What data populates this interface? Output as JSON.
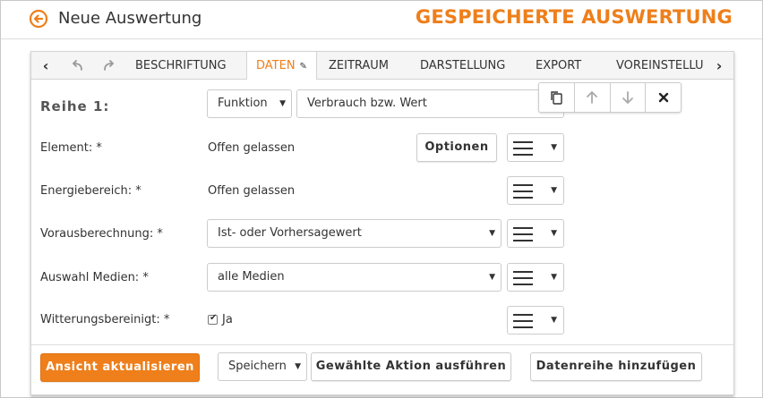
{
  "header": {
    "back_label": "Neue Auswertung",
    "headline": "GESPEICHERTE AUSWERTUNG"
  },
  "tabs": [
    {
      "label": "BESCHRIFTUNG"
    },
    {
      "label": "DATEN",
      "active": true
    },
    {
      "label": "ZEITRAUM"
    },
    {
      "label": "DARSTELLUNG"
    },
    {
      "label": "EXPORT"
    },
    {
      "label": "VOREINSTELLU"
    }
  ],
  "series": {
    "label": "Reihe 1:",
    "function_select": "Funktion",
    "function_value": "Verbrauch bzw. Wert"
  },
  "fields": {
    "element": {
      "label": "Element: *",
      "value": "Offen gelassen",
      "options_button": "Optionen"
    },
    "energy": {
      "label": "Energiebereich: *",
      "value": "Offen gelassen"
    },
    "forecast": {
      "label": "Vorausberechnung: *",
      "value": "Ist- oder Vorhersagewert"
    },
    "media": {
      "label": "Auswahl Medien: *",
      "value": "alle Medien"
    },
    "weather": {
      "label": "Witterungsbereinigt: *",
      "checkbox_label": "Ja",
      "checked": true
    }
  },
  "footer": {
    "update_button": "Ansicht aktualisieren",
    "action_select": "Speichern",
    "execute_button": "Gewählte Aktion ausführen",
    "add_series_button": "Datenreihe hinzufügen"
  },
  "colors": {
    "accent": "#ee7f1b"
  }
}
